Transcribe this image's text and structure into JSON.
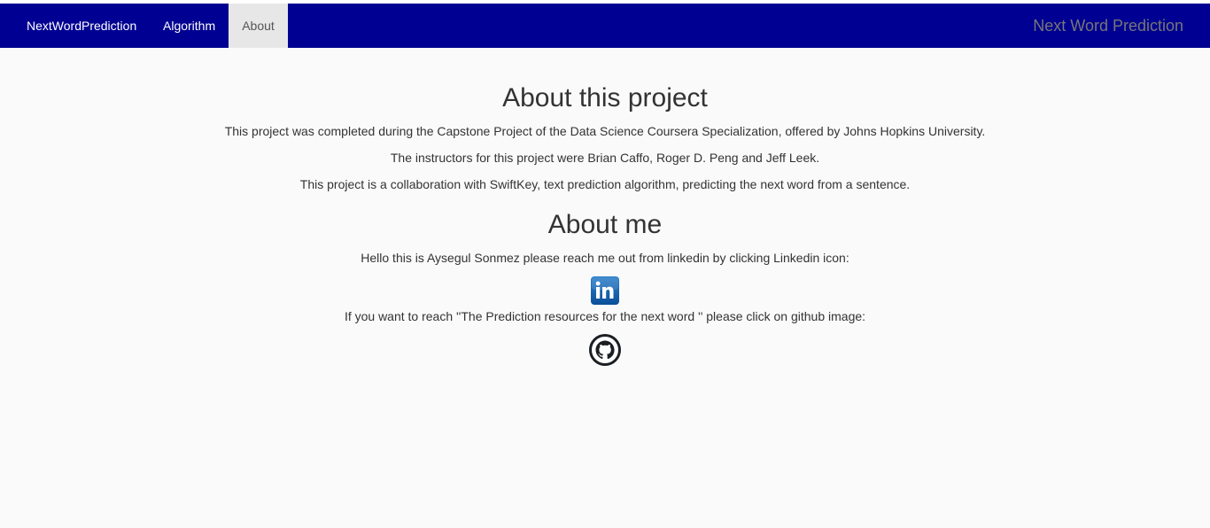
{
  "navbar": {
    "brand": "NextWordPrediction",
    "tabs": [
      {
        "label": "Algorithm"
      },
      {
        "label": "About",
        "active": true
      }
    ],
    "title": "Next Word Prediction",
    "bg_color": "#000092",
    "active_bg_color": "#e7e7e7"
  },
  "project": {
    "heading": "About this project",
    "paragraphs": [
      "This project was completed during the Capstone Project of the Data Science Coursera Specialization, offered by Johns Hopkins University.",
      "The instructors for this project were Brian Caffo, Roger D. Peng and Jeff Leek.",
      "This project is a collaboration with SwiftKey, text prediction algorithm, predicting the next word from a sentence."
    ]
  },
  "about_me": {
    "heading": "About me",
    "linkedin_text": "Hello this is Aysegul Sonmez please reach me out from linkedin by clicking Linkedin icon:",
    "linkedin_icon": "linkedin-icon",
    "github_text": "If you want to reach ''The Prediction resources for the next word '' please click on github image:",
    "github_icon": "github-icon"
  }
}
